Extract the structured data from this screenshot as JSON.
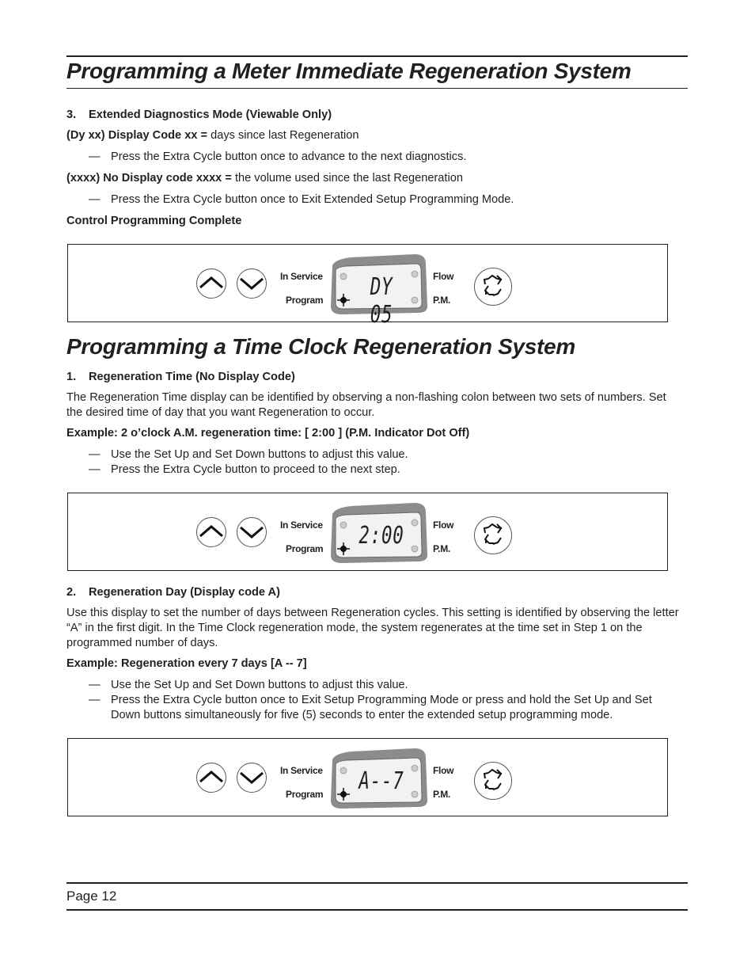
{
  "section1": {
    "title": "Programming a Meter Immediate Regeneration System",
    "step": {
      "number": "3.",
      "heading": "Extended Diagnostics Mode (Viewable Only)",
      "line1_bold": "(Dy xx) Display Code xx = ",
      "line1_text": "days since last Regeneration",
      "dash1": "Press the Extra Cycle button once to advance to the next diagnostics.",
      "line2_bold": "(xxxx) No Display code xxxx = ",
      "line2_text": "the volume used since the last Regeneration",
      "dash2": "Press the Extra Cycle button once to Exit Extended Setup Programming Mode.",
      "complete": "Control Programming Complete"
    },
    "panel": {
      "display": "DY 05"
    }
  },
  "section2": {
    "title": "Programming a Time Clock Regeneration System",
    "step1": {
      "number": "1.",
      "heading": "Regeneration Time (No Display Code)",
      "body": "The Regeneration Time display can be identified by observing a non-flashing colon between two sets of numbers. Set the desired time of day that you want Regeneration to occur.",
      "example": "Example: 2 o’clock A.M. regeneration time:  [ 2:00 ] (P.M. Indicator Dot Off)",
      "dash1": "Use the Set Up and Set Down buttons to adjust this value.",
      "dash2": "Press the Extra Cycle button to proceed to the next step."
    },
    "panel1": {
      "display": "2:00"
    },
    "step2": {
      "number": "2.",
      "heading": "Regeneration Day (Display code A)",
      "body": "Use this display to set the number of days between Regeneration cycles. This setting is identified by observing the letter “A” in the first digit. In the Time Clock regeneration mode, the system regenerates at the time set in Step 1 on the programmed number of days.",
      "example": "Example: Regeneration every 7 days   [A -- 7]",
      "dash1": "Use the Set Up and Set Down buttons to adjust this value.",
      "dash2": "Press the Extra Cycle button once to Exit Setup Programming Mode or press and hold the Set Up and Set Down buttons simultaneously for five (5) seconds to enter the extended setup programming mode."
    },
    "panel2": {
      "display": "A--7"
    }
  },
  "control_labels": {
    "in_service": "In Service",
    "program": "Program",
    "flow": "Flow",
    "pm": "P.M.",
    "dash": "—"
  },
  "icons": {
    "up": "chevron-up-icon",
    "down": "chevron-down-icon",
    "extra_cycle": "recycle-arrows-icon"
  },
  "footer": {
    "page": "Page 12"
  }
}
